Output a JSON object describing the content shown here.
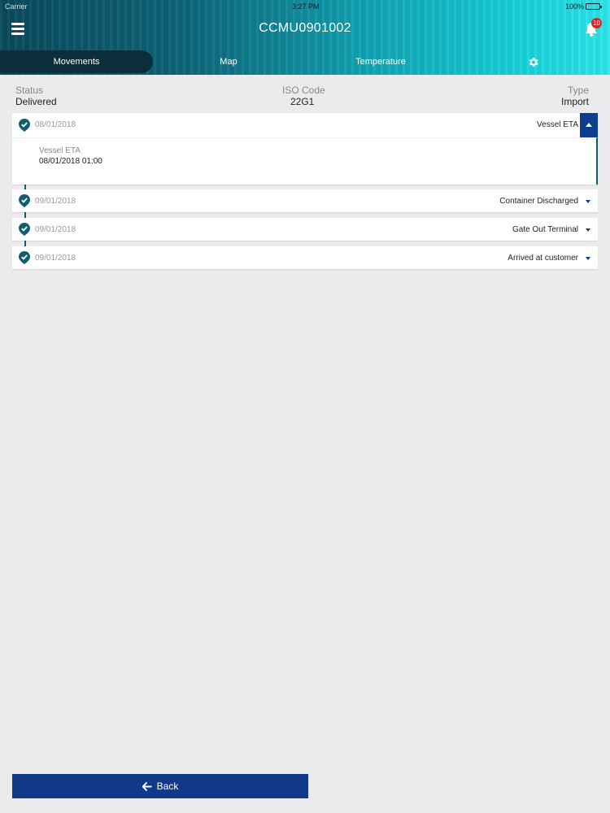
{
  "statusbar": {
    "carrier": "Carrier",
    "time": "3:27 PM",
    "battery": "100%"
  },
  "header": {
    "title": "CCMU0901002",
    "notification_count": "10",
    "icons": {
      "menu": "hamburger-menu-icon",
      "bell": "bell-icon",
      "gear": "gear-icon"
    },
    "gradient_colors": [
      "#0b4a5e",
      "#12a4b4",
      "#2de8ec"
    ]
  },
  "tabs": [
    {
      "label": "Movements",
      "active": true
    },
    {
      "label": "Map",
      "active": false
    },
    {
      "label": "Temperature",
      "active": false
    }
  ],
  "info": {
    "status_label": "Status",
    "status_value": "Delivered",
    "iso_label": "ISO Code",
    "iso_value": "22G1",
    "type_label": "Type",
    "type_value": "Import"
  },
  "movements": [
    {
      "date": "08/01/2018",
      "event": "Vessel ETA",
      "expanded": true,
      "detail_label": "Vessel ETA",
      "detail_value": "08/01/2018 01:00"
    },
    {
      "date": "09/01/2018",
      "event": "Container Discharged",
      "expanded": false
    },
    {
      "date": "09/01/2018",
      "event": "Gate Out Terminal",
      "expanded": false
    },
    {
      "date": "09/01/2018",
      "event": "Arrived at customer",
      "expanded": false
    }
  ],
  "footer": {
    "back_label": "Back"
  },
  "colors": {
    "accent": "#11398a",
    "timeline": "#0f5d6e",
    "background": "#ebebed"
  }
}
